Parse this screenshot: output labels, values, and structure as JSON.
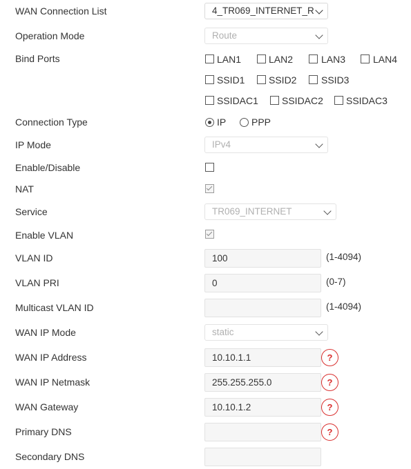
{
  "form": {
    "wan_connection_list": {
      "label": "WAN Connection List",
      "value": "4_TR069_INTERNET_R"
    },
    "operation_mode": {
      "label": "Operation Mode",
      "value": "Route"
    },
    "bind_ports": {
      "label": "Bind Ports",
      "ports": [
        {
          "name": "LAN1",
          "checked": false
        },
        {
          "name": "LAN2",
          "checked": false
        },
        {
          "name": "LAN3",
          "checked": false
        },
        {
          "name": "LAN4",
          "checked": false
        },
        {
          "name": "SSID1",
          "checked": false
        },
        {
          "name": "SSID2",
          "checked": false
        },
        {
          "name": "SSID3",
          "checked": false
        },
        {
          "name": "SSIDAC1",
          "checked": false
        },
        {
          "name": "SSIDAC2",
          "checked": false
        },
        {
          "name": "SSIDAC3",
          "checked": false
        }
      ]
    },
    "connection_type": {
      "label": "Connection Type",
      "options": [
        "IP",
        "PPP"
      ],
      "selected": "IP"
    },
    "ip_mode": {
      "label": "IP Mode",
      "value": "IPv4"
    },
    "enable_disable": {
      "label": "Enable/Disable",
      "checked": false
    },
    "nat": {
      "label": "NAT",
      "checked": true
    },
    "service": {
      "label": "Service",
      "value": "TR069_INTERNET"
    },
    "enable_vlan": {
      "label": "Enable VLAN",
      "checked": true
    },
    "vlan_id": {
      "label": "VLAN ID",
      "value": "100",
      "hint": "(1-4094)"
    },
    "vlan_pri": {
      "label": "VLAN PRI",
      "value": "0",
      "hint": "(0-7)"
    },
    "multicast_vlan_id": {
      "label": "Multicast VLAN ID",
      "value": "",
      "hint": "(1-4094)"
    },
    "wan_ip_mode": {
      "label": "WAN IP Mode",
      "value": "static"
    },
    "wan_ip_address": {
      "label": "WAN IP Address",
      "value": "10.10.1.1",
      "help": "?"
    },
    "wan_ip_netmask": {
      "label": "WAN IP Netmask",
      "value": "255.255.255.0",
      "help": "?"
    },
    "wan_gateway": {
      "label": "WAN Gateway",
      "value": "10.10.1.2",
      "help": "?"
    },
    "primary_dns": {
      "label": "Primary DNS",
      "value": "",
      "help": "?"
    },
    "secondary_dns": {
      "label": "Secondary DNS",
      "value": ""
    }
  }
}
